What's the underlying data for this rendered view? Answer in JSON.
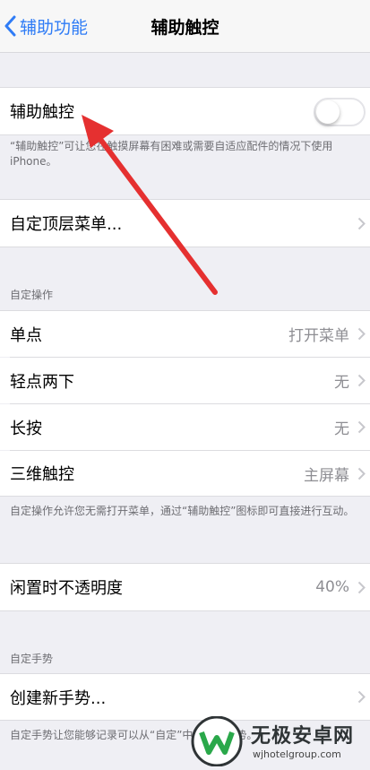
{
  "nav": {
    "back_label": "辅助功能",
    "title": "辅助触控"
  },
  "toggle_row": {
    "label": "辅助触控",
    "enabled": false
  },
  "toggle_footer": "“辅助触控”可让您在触摸屏幕有困难或需要自适应配件的情况下使用 iPhone。",
  "custom_menu": {
    "label": "自定顶层菜单..."
  },
  "actions_section": {
    "header": "自定操作",
    "rows": [
      {
        "label": "单点",
        "value": "打开菜单"
      },
      {
        "label": "轻点两下",
        "value": "无"
      },
      {
        "label": "长按",
        "value": "无"
      },
      {
        "label": "三维触控",
        "value": "主屏幕"
      }
    ],
    "footer": "自定操作允许您无需打开菜单，通过“辅助触控”图标即可直接进行互动。"
  },
  "opacity": {
    "label": "闲置时不透明度",
    "value": "40%"
  },
  "gestures_section": {
    "header": "自定手势",
    "create_label": "创建新手势...",
    "footer": "自定手势让您能够记录可以从“自定”中激活的手势。"
  },
  "watermark": {
    "brand": "无极安卓网",
    "url": "wjhotelgroup.com"
  },
  "colors": {
    "accent": "#2f7cf6",
    "arrow": "#e53030",
    "background": "#efeff4"
  }
}
